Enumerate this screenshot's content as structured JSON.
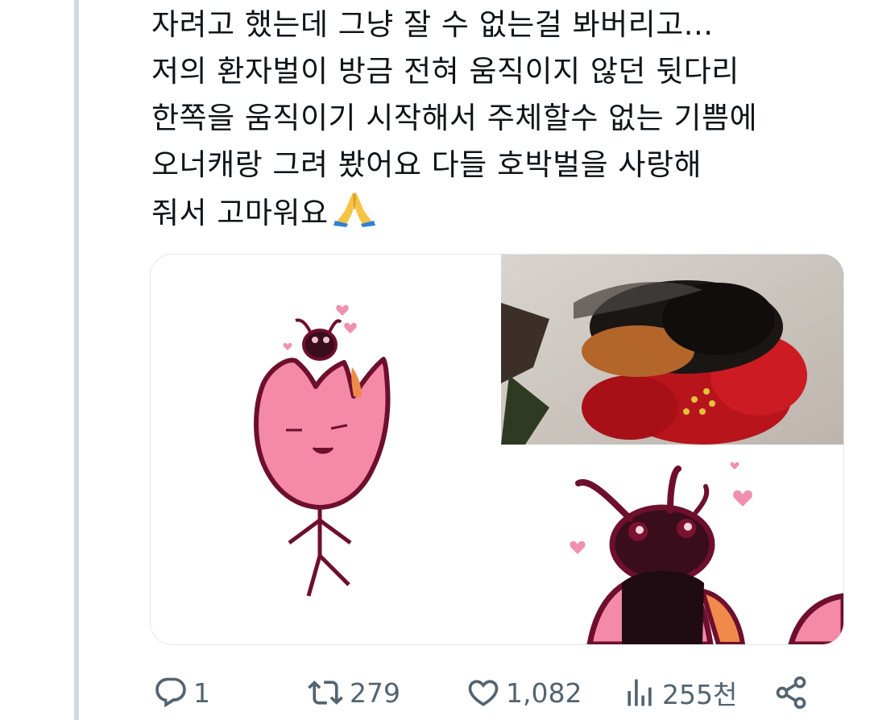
{
  "tweet": {
    "lines": [
      "자려고 했는데 그냥 잘 수 없는걸 봐버리고...",
      "저의 환자벌이 방금 전혀 움직이지 않던 뒷다리",
      "한쪽을 움직이기 시작해서 주체할수 없는 기쁨에",
      "오너캐랑 그려 봤어요 다들 호박벌을 사랑해",
      "줘서 고마워요"
    ],
    "emoji": "folded-hands-emoji"
  },
  "actions": {
    "reply_count": "1",
    "retweet_count": "279",
    "like_count": "1,082",
    "views_count": "255천"
  },
  "colors": {
    "text": "#0f1419",
    "secondary": "#536471",
    "thread_line": "#cfd9de",
    "pink": "#f58aa8",
    "maroon": "#7a1230"
  }
}
